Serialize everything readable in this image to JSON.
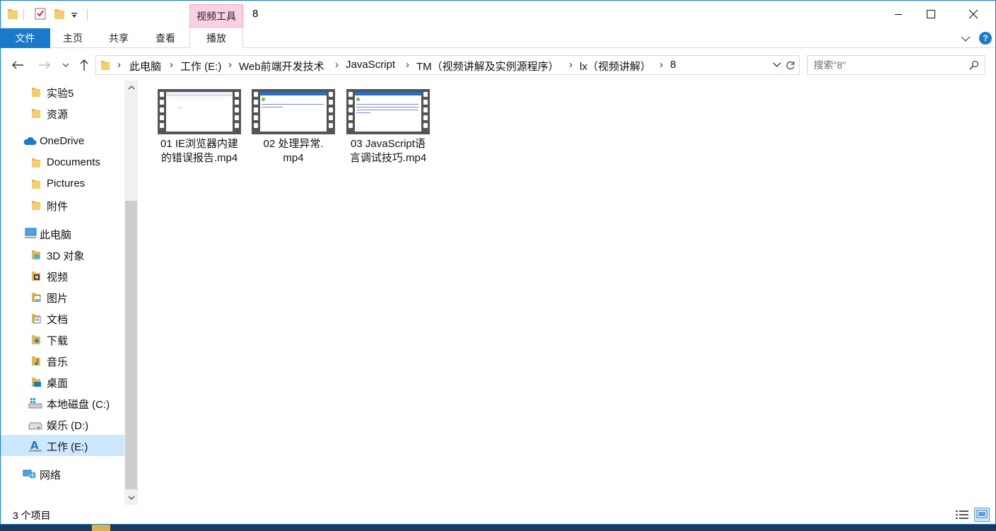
{
  "window": {
    "title": "8",
    "context_tab_group": "视频工具"
  },
  "ribbon": {
    "tabs": [
      {
        "label": "文件"
      },
      {
        "label": "主页"
      },
      {
        "label": "共享"
      },
      {
        "label": "查看"
      },
      {
        "label": "播放"
      }
    ]
  },
  "address": {
    "breadcrumbs": [
      "此电脑",
      "工作 (E:)",
      "Web前端开发技术",
      "JavaScript",
      "TM（视频讲解及实例源程序）",
      "lx（视频讲解）",
      "8"
    ]
  },
  "search": {
    "placeholder": "搜索\"8\""
  },
  "nav": {
    "items": [
      {
        "label": "实验5",
        "icon": "folder-icon"
      },
      {
        "label": "资源",
        "icon": "folder-icon"
      },
      {
        "label": "OneDrive",
        "icon": "cloud-icon"
      },
      {
        "label": "Documents",
        "icon": "folder-icon"
      },
      {
        "label": "Pictures",
        "icon": "folder-icon"
      },
      {
        "label": "附件",
        "icon": "folder-icon"
      },
      {
        "label": "此电脑",
        "icon": "computer-icon"
      },
      {
        "label": "3D 对象",
        "icon": "3d-objects-icon"
      },
      {
        "label": "视频",
        "icon": "videos-icon"
      },
      {
        "label": "图片",
        "icon": "pictures-icon"
      },
      {
        "label": "文档",
        "icon": "documents-icon"
      },
      {
        "label": "下载",
        "icon": "downloads-icon"
      },
      {
        "label": "音乐",
        "icon": "music-icon"
      },
      {
        "label": "桌面",
        "icon": "desktop-icon"
      },
      {
        "label": "本地磁盘 (C:)",
        "icon": "windows-drive-icon"
      },
      {
        "label": "娱乐 (D:)",
        "icon": "drive-icon"
      },
      {
        "label": "工作 (E:)",
        "icon": "drive-a-icon",
        "selected": true
      },
      {
        "label": "网络",
        "icon": "network-icon"
      }
    ]
  },
  "files": [
    {
      "line1": "01 IE浏览器内建",
      "line2": "的错误报告.mp4"
    },
    {
      "line1": "02 处理异常.",
      "line2": "mp4"
    },
    {
      "line1": "03 JavaScript语",
      "line2": "言调试技巧.mp4"
    }
  ],
  "status": {
    "item_count": "3 个项目"
  },
  "colors": {
    "accent": "#1979ca",
    "context_tab": "#f9d0e4",
    "selection": "#cce8ff"
  }
}
